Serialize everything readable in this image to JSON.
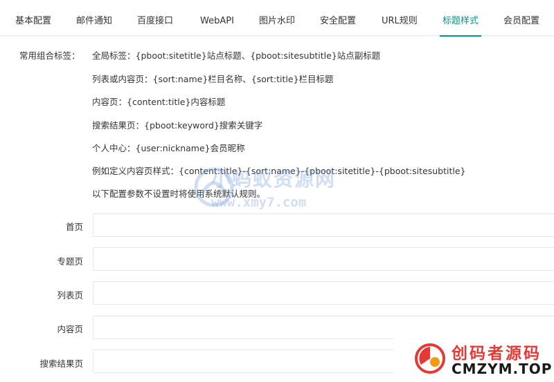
{
  "tabs": [
    {
      "label": "基本配置",
      "active": false
    },
    {
      "label": "邮件通知",
      "active": false
    },
    {
      "label": "百度接口",
      "active": false
    },
    {
      "label": "WebAPI",
      "active": false
    },
    {
      "label": "图片水印",
      "active": false
    },
    {
      "label": "安全配置",
      "active": false
    },
    {
      "label": "URL规则",
      "active": false
    },
    {
      "label": "标题样式",
      "active": true
    },
    {
      "label": "会员配置",
      "active": false
    }
  ],
  "info": {
    "label": "常用组合标签：",
    "lines": [
      "全局标签：{pboot:sitetitle}站点标题、{pboot:sitesubtitle}站点副标题",
      "列表或内容页：{sort:name}栏目名称、{sort:title}栏目标题",
      "内容页：{content:title}内容标题",
      "搜索结果页：{pboot:keyword}搜索关键字",
      "个人中心：{user:nickname}会员昵称",
      "例如定义内容页样式：{content:title}-{sort:name}-{pboot:sitetitle}-{pboot:sitesubtitle}",
      "以下配置参数不设置时将使用系统默认规则。"
    ]
  },
  "fields": [
    {
      "label": "首页",
      "value": ""
    },
    {
      "label": "专题页",
      "value": ""
    },
    {
      "label": "列表页",
      "value": ""
    },
    {
      "label": "内容页",
      "value": ""
    },
    {
      "label": "搜索结果页",
      "value": ""
    }
  ],
  "watermarks": {
    "center_title": "小蚂蚁资源网",
    "center_url": "www.xmy7.com",
    "corner_title": "创码者源码",
    "corner_sub": "CMZYM.TOP"
  },
  "colors": {
    "accent": "#009688",
    "border": "#e6e6e6",
    "text": "#333333",
    "corner_title": "#e53935"
  }
}
